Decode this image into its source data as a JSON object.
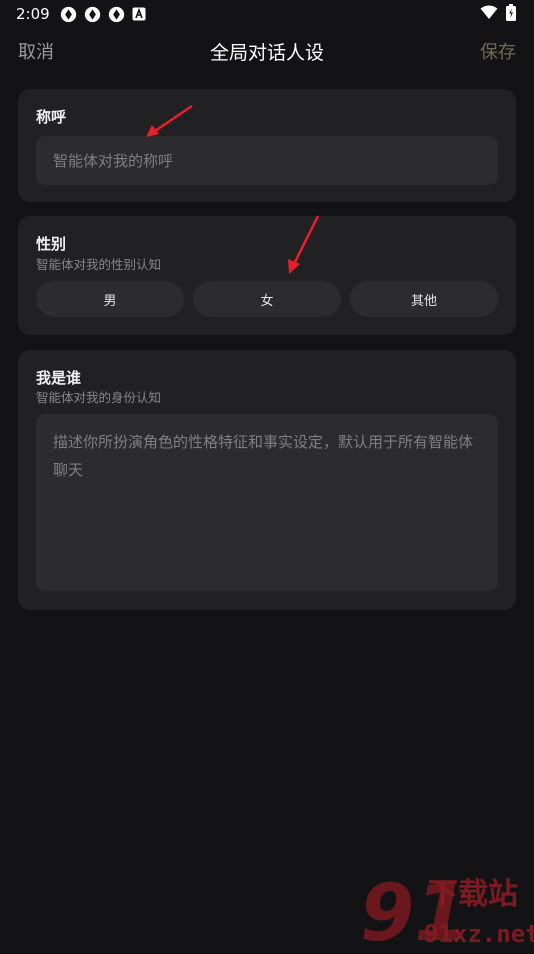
{
  "status_bar": {
    "time": "2:09"
  },
  "header": {
    "cancel_label": "取消",
    "title": "全局对话人设",
    "save_label": "保存"
  },
  "nickname_card": {
    "title": "称呼",
    "placeholder": "智能体对我的称呼"
  },
  "gender_card": {
    "title": "性别",
    "subtitle": "智能体对我的性别认知",
    "options": [
      "男",
      "女",
      "其他"
    ]
  },
  "identity_card": {
    "title": "我是谁",
    "subtitle": "智能体对我的身份认知",
    "placeholder": "描述你所扮演角色的性格特征和事实设定，默认用于所有智能体聊天"
  },
  "watermark": {
    "text": "下载站",
    "url_text": "91xz.net"
  },
  "colors": {
    "background": "#131315",
    "card": "#212124",
    "input": "#2c2c30",
    "annotation_arrow": "#e8202a",
    "save_disabled": "#6f6a55"
  }
}
